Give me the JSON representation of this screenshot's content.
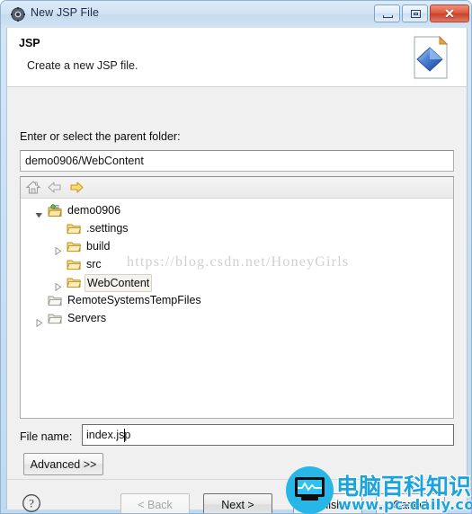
{
  "window": {
    "title": "New JSP File",
    "icon": "jsp-wizard-icon",
    "controls": {
      "minimize": "minimize-icon",
      "maximize": "maximize-icon",
      "close": "✕"
    }
  },
  "header": {
    "title": "JSP",
    "subtitle": "Create a new JSP file.",
    "icon": "jsp-page-icon"
  },
  "form": {
    "parent_folder_label": "Enter or select the parent folder:",
    "parent_folder_value": "demo0906/WebContent",
    "file_name_label": "File name:",
    "file_name_value": "index.jsp",
    "advanced_label": "Advanced >>"
  },
  "tree": {
    "toolbar": [
      {
        "name": "home-icon",
        "enabled": false
      },
      {
        "name": "back-arrow-icon",
        "enabled": false
      },
      {
        "name": "forward-arrow-icon",
        "enabled": true
      }
    ],
    "nodes": [
      {
        "label": "demo0906",
        "depth": 0,
        "twisty": "expanded",
        "icon": "project-folder-icon",
        "selected": false
      },
      {
        "label": ".settings",
        "depth": 1,
        "twisty": "none",
        "icon": "folder-open-icon",
        "selected": false
      },
      {
        "label": "build",
        "depth": 1,
        "twisty": "collapsed",
        "icon": "folder-open-icon",
        "selected": false
      },
      {
        "label": "src",
        "depth": 1,
        "twisty": "none",
        "icon": "folder-open-icon",
        "selected": false
      },
      {
        "label": "WebContent",
        "depth": 1,
        "twisty": "collapsed",
        "icon": "folder-open-icon",
        "selected": true
      },
      {
        "label": "RemoteSystemsTempFiles",
        "depth": 0,
        "twisty": "none",
        "icon": "folder-grey-icon",
        "selected": false
      },
      {
        "label": "Servers",
        "depth": 0,
        "twisty": "collapsed",
        "icon": "folder-grey-icon",
        "selected": false
      }
    ]
  },
  "buttons": {
    "help": "?",
    "back": "< Back",
    "next": "Next >",
    "finish": "Finish",
    "cancel": "Cancel"
  },
  "watermarks": {
    "csdn": "https://blog.csdn.net/HoneyGirls",
    "logo_cn": "电脑百科知识",
    "logo_url": "www.pc-daily.com"
  },
  "colors": {
    "accent": "#27b6e8",
    "title_bar": "#cfe2f3",
    "close_button": "#d9563a",
    "dialog_bg": "#f0f0f0",
    "folder_yellow": "#f0b93c"
  }
}
